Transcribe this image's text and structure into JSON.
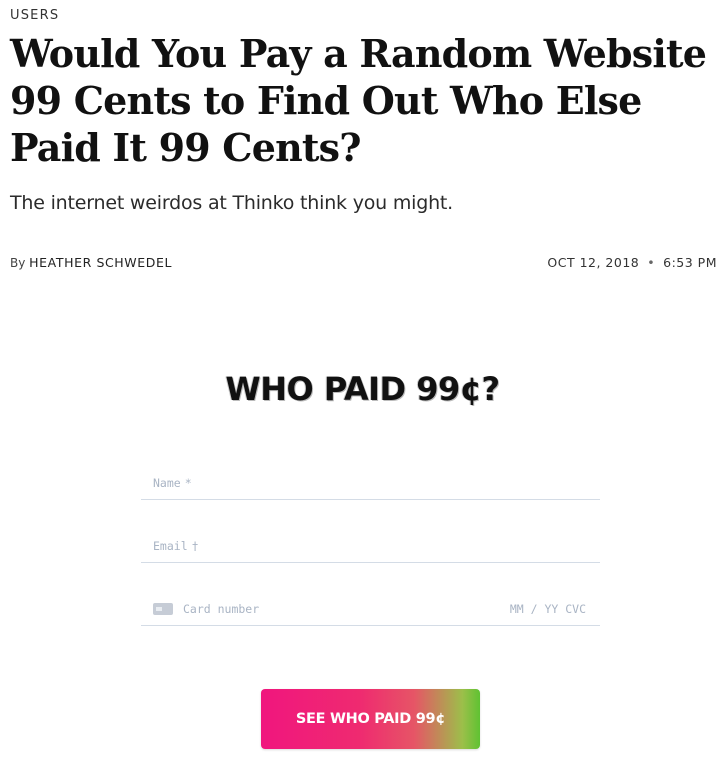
{
  "article": {
    "section": "USERS",
    "headline": "Would You Pay a Random Website 99 Cents to Find Out Who Else Paid It 99 Cents?",
    "dek": "The internet weirdos at Thinko think you might.",
    "byline_prefix": "By",
    "author": "HEATHER SCHWEDEL",
    "date": "OCT 12, 2018",
    "date_separator": "•",
    "time": "6:53 PM"
  },
  "widget": {
    "title": "WHO PAID 99¢?",
    "fields": {
      "name": {
        "placeholder": "Name",
        "marker": "*"
      },
      "email": {
        "placeholder": "Email",
        "marker": "†"
      },
      "card": {
        "placeholder": "Card number",
        "expiry_placeholder": "MM / YY CVC",
        "icon": "credit-card-icon"
      }
    },
    "submit_label": "SEE WHO PAID 99¢"
  },
  "colors": {
    "field_border": "#d4dce6",
    "placeholder": "#a9b4c4",
    "button_gradient_start": "#f0167e",
    "button_gradient_end": "#5fc232",
    "button_text": "#ffffff"
  }
}
